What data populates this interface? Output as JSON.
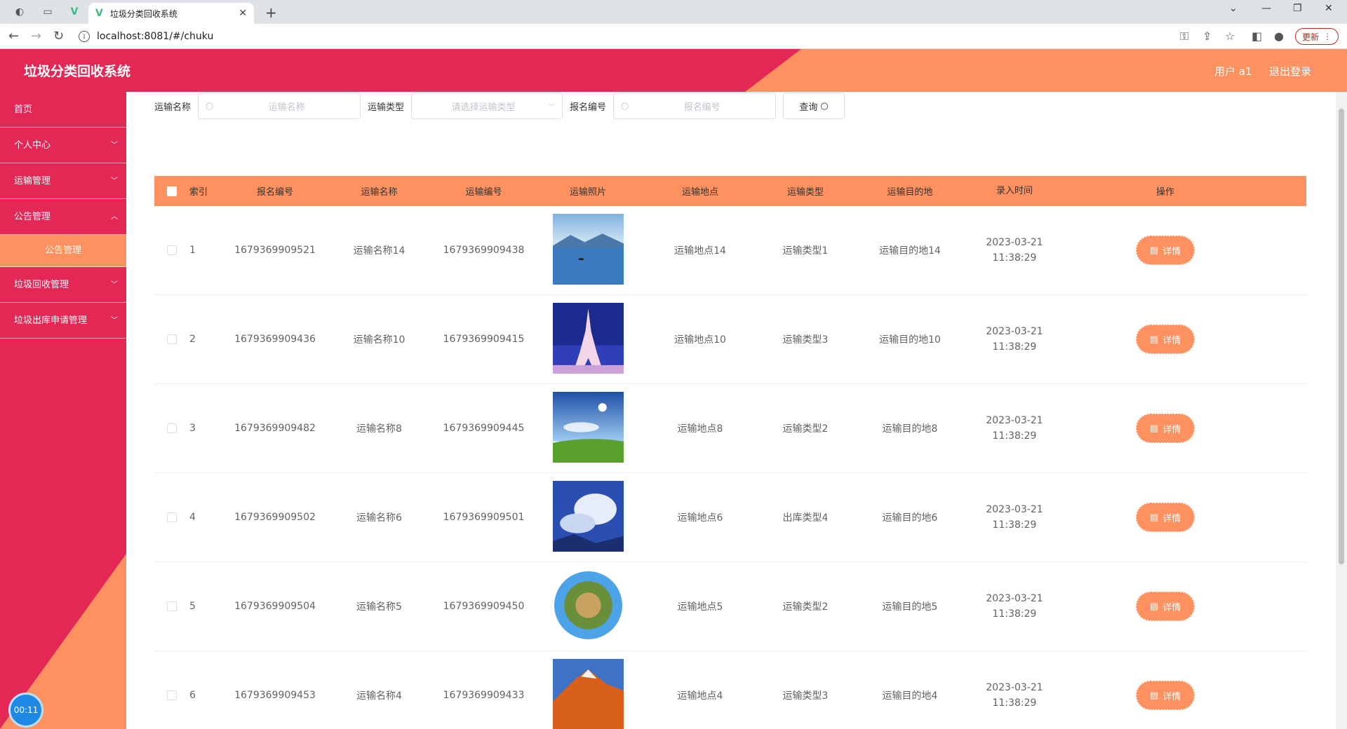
{
  "browser": {
    "tab_title": "垃圾分类回收系统",
    "url": "localhost:8081/#/chuku",
    "update_label": "更新"
  },
  "header": {
    "title": "垃圾分类回收系统",
    "user": "用户 a1",
    "logout": "退出登录"
  },
  "sidebar": {
    "items": [
      {
        "label": "首页",
        "has_children": false
      },
      {
        "label": "个人中心",
        "has_children": true
      },
      {
        "label": "运输管理",
        "has_children": true
      },
      {
        "label": "公告管理",
        "has_children": true
      },
      {
        "label": "公告管理",
        "sub": true
      },
      {
        "label": "垃圾回收管理",
        "has_children": true
      },
      {
        "label": "垃圾出库申请管理",
        "has_children": true
      }
    ],
    "timer": "00:11"
  },
  "search": {
    "name_label": "运输名称",
    "name_placeholder": "运输名称",
    "type_label": "运输类型",
    "type_placeholder": "请选择运输类型",
    "bm_label": "报名编号",
    "bm_placeholder": "报名编号",
    "query_label": "查询"
  },
  "table": {
    "headers": [
      "索引",
      "报名编号",
      "运输名称",
      "运输编号",
      "运输照片",
      "运输地点",
      "运输类型",
      "运输目的地",
      "录入时间",
      "操作"
    ],
    "detail_label": "详情",
    "rows": [
      {
        "idx": "1",
        "bm": "1679369909521",
        "name": "运输名称14",
        "no": "1679369909438",
        "loc": "运输地点14",
        "type": "运输类型1",
        "dest": "运输目的地14",
        "time": "2023-03-21 11:38:29",
        "photo": "lake"
      },
      {
        "idx": "2",
        "bm": "1679369909436",
        "name": "运输名称10",
        "no": "1679369909415",
        "loc": "运输地点10",
        "type": "运输类型3",
        "dest": "运输目的地10",
        "time": "2023-03-21 11:38:29",
        "photo": "eiffel"
      },
      {
        "idx": "3",
        "bm": "1679369909482",
        "name": "运输名称8",
        "no": "1679369909445",
        "loc": "运输地点8",
        "type": "运输类型2",
        "dest": "运输目的地8",
        "time": "2023-03-21 11:38:29",
        "photo": "meadow"
      },
      {
        "idx": "4",
        "bm": "1679369909502",
        "name": "运输名称6",
        "no": "1679369909501",
        "loc": "运输地点6",
        "type": "出库类型4",
        "dest": "运输目的地6",
        "time": "2023-03-21 11:38:29",
        "photo": "clouds"
      },
      {
        "idx": "5",
        "bm": "1679369909504",
        "name": "运输名称5",
        "no": "1679369909450",
        "loc": "运输地点5",
        "type": "运输类型2",
        "dest": "运输目的地5",
        "time": "2023-03-21 11:38:29",
        "photo": "planet"
      },
      {
        "idx": "6",
        "bm": "1679369909453",
        "name": "运输名称4",
        "no": "1679369909433",
        "loc": "运输地点4",
        "type": "运输类型3",
        "dest": "运输目的地4",
        "time": "2023-03-21 11:38:29",
        "photo": "canyon"
      }
    ]
  },
  "colors": {
    "pink": "#e42856",
    "orange": "#fd9260"
  }
}
